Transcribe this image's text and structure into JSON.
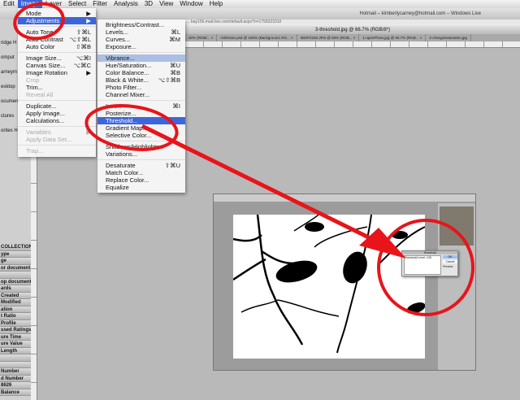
{
  "menubar": [
    "Edit",
    "Image",
    "Layer",
    "Select",
    "Filter",
    "Analysis",
    "3D",
    "View",
    "Window",
    "Help"
  ],
  "window_title": "Hotmail – kimberlycarney@hotmail.com – Windows Live",
  "url": "…bay156.mail.live.com/default.aspx?n=1758323310",
  "document_title": "3-threshold.jpg @ 66.7% (RGB/8*)",
  "tabs": [
    "30% (RGB/... ×",
    "rickRosie.psd @ 100% (Background, RG... ×",
    "IMGP2160.JPG @ 50% (RGB... ×",
    "1-openPhoto.jpg @ 66.7% (RGB... ×",
    "2-changeSaturation.jpg"
  ],
  "image_menu": [
    {
      "label": "Mode",
      "sub": "▶"
    },
    {
      "label": "Adjustments",
      "sub": "▶",
      "state": "sel"
    },
    {
      "sep": true
    },
    {
      "label": "Auto Tone",
      "sc": "⇧⌘L"
    },
    {
      "label": "Auto Contrast",
      "sc": "⌥⇧⌘L"
    },
    {
      "label": "Auto Color",
      "sc": "⇧⌘B"
    },
    {
      "sep": true
    },
    {
      "label": "Image Size...",
      "sc": "⌥⌘I"
    },
    {
      "label": "Canvas Size...",
      "sc": "⌥⌘C"
    },
    {
      "label": "Image Rotation",
      "sub": "▶"
    },
    {
      "label": "Crop",
      "state": "dis"
    },
    {
      "label": "Trim..."
    },
    {
      "label": "Reveal All",
      "state": "dis"
    },
    {
      "sep": true
    },
    {
      "label": "Duplicate..."
    },
    {
      "label": "Apply Image..."
    },
    {
      "label": "Calculations..."
    },
    {
      "sep": true
    },
    {
      "label": "Variables",
      "sub": "▶",
      "state": "dis"
    },
    {
      "label": "Apply Data Set...",
      "state": "dis"
    },
    {
      "sep": true
    },
    {
      "label": "Trap...",
      "state": "dis"
    }
  ],
  "adjustments_menu": [
    {
      "label": "Brightness/Contrast..."
    },
    {
      "label": "Levels...",
      "sc": "⌘L"
    },
    {
      "label": "Curves...",
      "sc": "⌘M"
    },
    {
      "label": "Exposure..."
    },
    {
      "sep": true
    },
    {
      "label": "Vibrance...",
      "state": "hl"
    },
    {
      "label": "Hue/Saturation...",
      "sc": "⌘U"
    },
    {
      "label": "Color Balance...",
      "sc": "⌘B"
    },
    {
      "label": "Black & White...",
      "sc": "⌥⇧⌘B"
    },
    {
      "label": "Photo Filter..."
    },
    {
      "label": "Channel Mixer..."
    },
    {
      "sep": true
    },
    {
      "label": "Invert",
      "sc": "⌘I"
    },
    {
      "label": "Posterize..."
    },
    {
      "label": "Threshold...",
      "state": "sel"
    },
    {
      "label": "Gradient Map..."
    },
    {
      "label": "Selective Color..."
    },
    {
      "sep": true
    },
    {
      "label": "Shadows/Highlights..."
    },
    {
      "label": "Variations..."
    },
    {
      "sep": true
    },
    {
      "label": "Desaturate",
      "sc": "⇧⌘U"
    },
    {
      "label": "Match Color..."
    },
    {
      "label": "Replace Color..."
    },
    {
      "label": "Equalize"
    }
  ],
  "left_panel_top": [
    "ridge H",
    "omput",
    "arneym",
    "esktop",
    "ocumen",
    "ctures",
    "orites H"
  ],
  "left_panel_meta": [
    "COLLECTIONS",
    "ype",
    "ge",
    "or document",
    "",
    "op document",
    "ards",
    "Created",
    "Modified",
    "ation",
    "t Ratio",
    "Profile",
    "ssed Ratings",
    "ure Time",
    "ure Value",
    "Length",
    "",
    "",
    "Number",
    "d Number",
    "8626",
    "Balance"
  ],
  "threshold_dialog": {
    "title": "Threshold",
    "level_label": "Threshold Level:",
    "level": "128",
    "ok": "OK",
    "cancel": "Cancel",
    "preview": "Preview"
  },
  "annotation_color": "#e8141a"
}
